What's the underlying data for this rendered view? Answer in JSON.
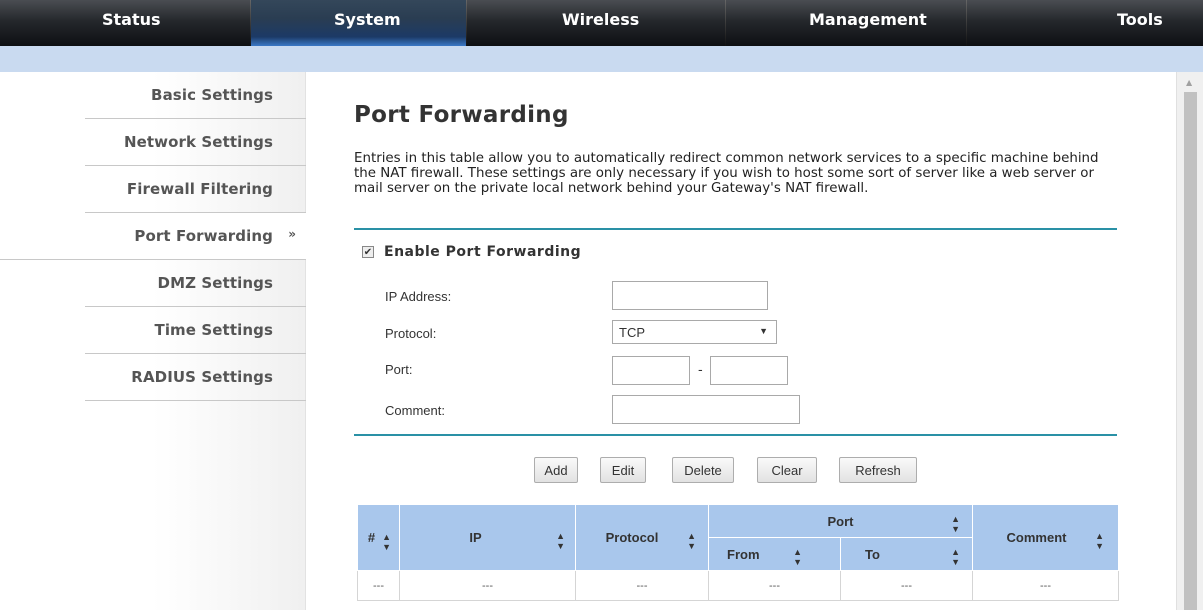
{
  "nav": {
    "tabs": [
      {
        "label": "Status"
      },
      {
        "label": "System",
        "active": true
      },
      {
        "label": "Wireless"
      },
      {
        "label": "Management"
      },
      {
        "label": "Tools"
      }
    ]
  },
  "sidebar": {
    "items": [
      {
        "label": "Basic Settings"
      },
      {
        "label": "Network Settings"
      },
      {
        "label": "Firewall Filtering"
      },
      {
        "label": "Port Forwarding",
        "active": true,
        "indicator": "»"
      },
      {
        "label": "DMZ Settings"
      },
      {
        "label": "Time Settings"
      },
      {
        "label": "RADIUS Settings"
      }
    ]
  },
  "page": {
    "title": "Port Forwarding",
    "description": "Entries in this table allow you to automatically redirect common network services to a specific machine behind the NAT firewall. These settings are only necessary if you wish to host some sort of server like a web server or mail server on the private local network behind your Gateway's NAT firewall.",
    "enable_label": "Enable Port Forwarding",
    "enable_checked": true
  },
  "form": {
    "ip_label": "IP Address:",
    "ip_value": "",
    "protocol_label": "Protocol:",
    "protocol_value": "TCP",
    "port_label": "Port:",
    "port_from_value": "",
    "port_separator": "-",
    "port_to_value": "",
    "comment_label": "Comment:",
    "comment_value": ""
  },
  "buttons": {
    "add": "Add",
    "edit": "Edit",
    "delete": "Delete",
    "clear": "Clear",
    "refresh": "Refresh"
  },
  "table": {
    "headers": {
      "num": "#",
      "ip": "IP",
      "protocol": "Protocol",
      "port": "Port",
      "from": "From",
      "to": "To",
      "comment": "Comment"
    },
    "sort_icon": "sort-arrows-icon",
    "rows": [
      {
        "num": "---",
        "ip": "---",
        "protocol": "---",
        "from": "---",
        "to": "---",
        "comment": "---"
      }
    ]
  },
  "colors": {
    "accent_rule": "#2a91a6",
    "table_header": "#a9c7ec",
    "sub_strip": "#c9daf0"
  }
}
